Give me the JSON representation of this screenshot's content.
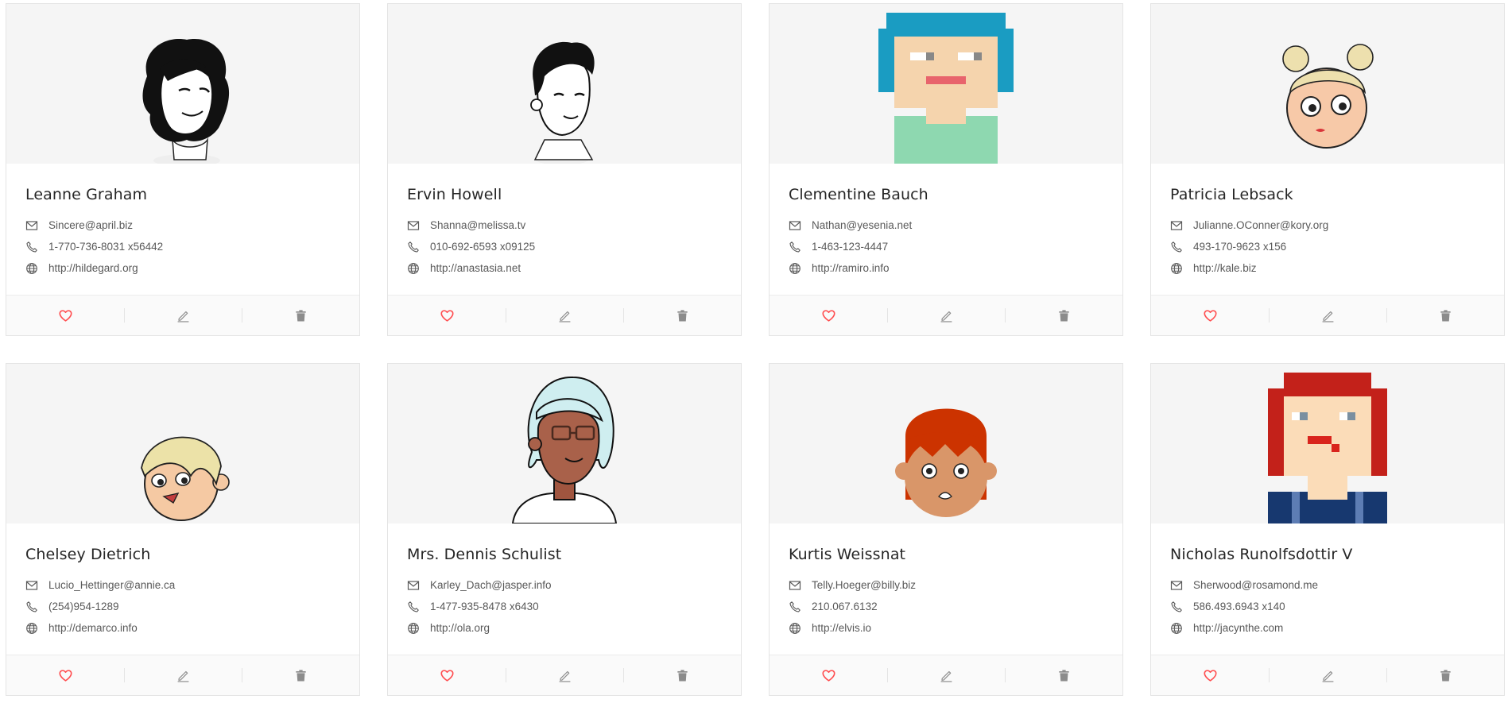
{
  "colors": {
    "heart": "#ff4d4f",
    "icon": "#8c8c8c",
    "cover_bg": "#f5f5f5"
  },
  "action_icons": [
    "heart-icon",
    "edit-icon",
    "delete-icon"
  ],
  "users": [
    {
      "name": "Leanne Graham",
      "email": "Sincere@april.biz",
      "phone": "1-770-736-8031 x56442",
      "website": "http://hildegard.org",
      "avatar": "avatar-lineart-curly"
    },
    {
      "name": "Ervin Howell",
      "email": "Shanna@melissa.tv",
      "phone": "010-692-6593 x09125",
      "website": "http://anastasia.net",
      "avatar": "avatar-lineart-short"
    },
    {
      "name": "Clementine Bauch",
      "email": "Nathan@yesenia.net",
      "phone": "1-463-123-4447",
      "website": "http://ramiro.info",
      "avatar": "avatar-pixel-blue-hair"
    },
    {
      "name": "Patricia Lebsack",
      "email": "Julianne.OConner@kory.org",
      "phone": "493-170-9623 x156",
      "website": "http://kale.biz",
      "avatar": "avatar-cartoon-buns"
    },
    {
      "name": "Chelsey Dietrich",
      "email": "Lucio_Hettinger@annie.ca",
      "phone": "(254)954-1289",
      "website": "http://demarco.info",
      "avatar": "avatar-cartoon-blond"
    },
    {
      "name": "Mrs. Dennis Schulist",
      "email": "Karley_Dach@jasper.info",
      "phone": "1-477-935-8478 x6430",
      "website": "http://ola.org",
      "avatar": "avatar-glasses"
    },
    {
      "name": "Kurtis Weissnat",
      "email": "Telly.Hoeger@billy.biz",
      "phone": "210.067.6132",
      "website": "http://elvis.io",
      "avatar": "avatar-cartoon-redhead"
    },
    {
      "name": "Nicholas Runolfsdottir V",
      "email": "Sherwood@rosamond.me",
      "phone": "586.493.6943 x140",
      "website": "http://jacynthe.com",
      "avatar": "avatar-pixel-red-hair"
    }
  ]
}
